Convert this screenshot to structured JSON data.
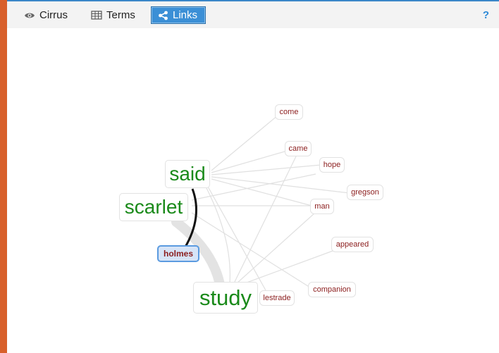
{
  "toolbar": {
    "tabs": [
      {
        "label": "Cirrus",
        "icon": "eye-icon"
      },
      {
        "label": "Terms",
        "icon": "table-icon"
      },
      {
        "label": "Links",
        "icon": "share-icon",
        "active": true
      }
    ],
    "help_label": "?"
  },
  "graph": {
    "keywords": [
      "said",
      "scarlet",
      "study"
    ],
    "focus_term": "holmes",
    "collocates": [
      "come",
      "came",
      "hope",
      "gregson",
      "man",
      "appeared",
      "companion",
      "lestrade"
    ]
  },
  "colors": {
    "accent_bar": "#d8602b",
    "active_tab": "#3b8fd6",
    "keyword_text": "#1a8a1a",
    "collocate_text": "#8b1d1d",
    "help_icon": "#2e8ad8"
  }
}
